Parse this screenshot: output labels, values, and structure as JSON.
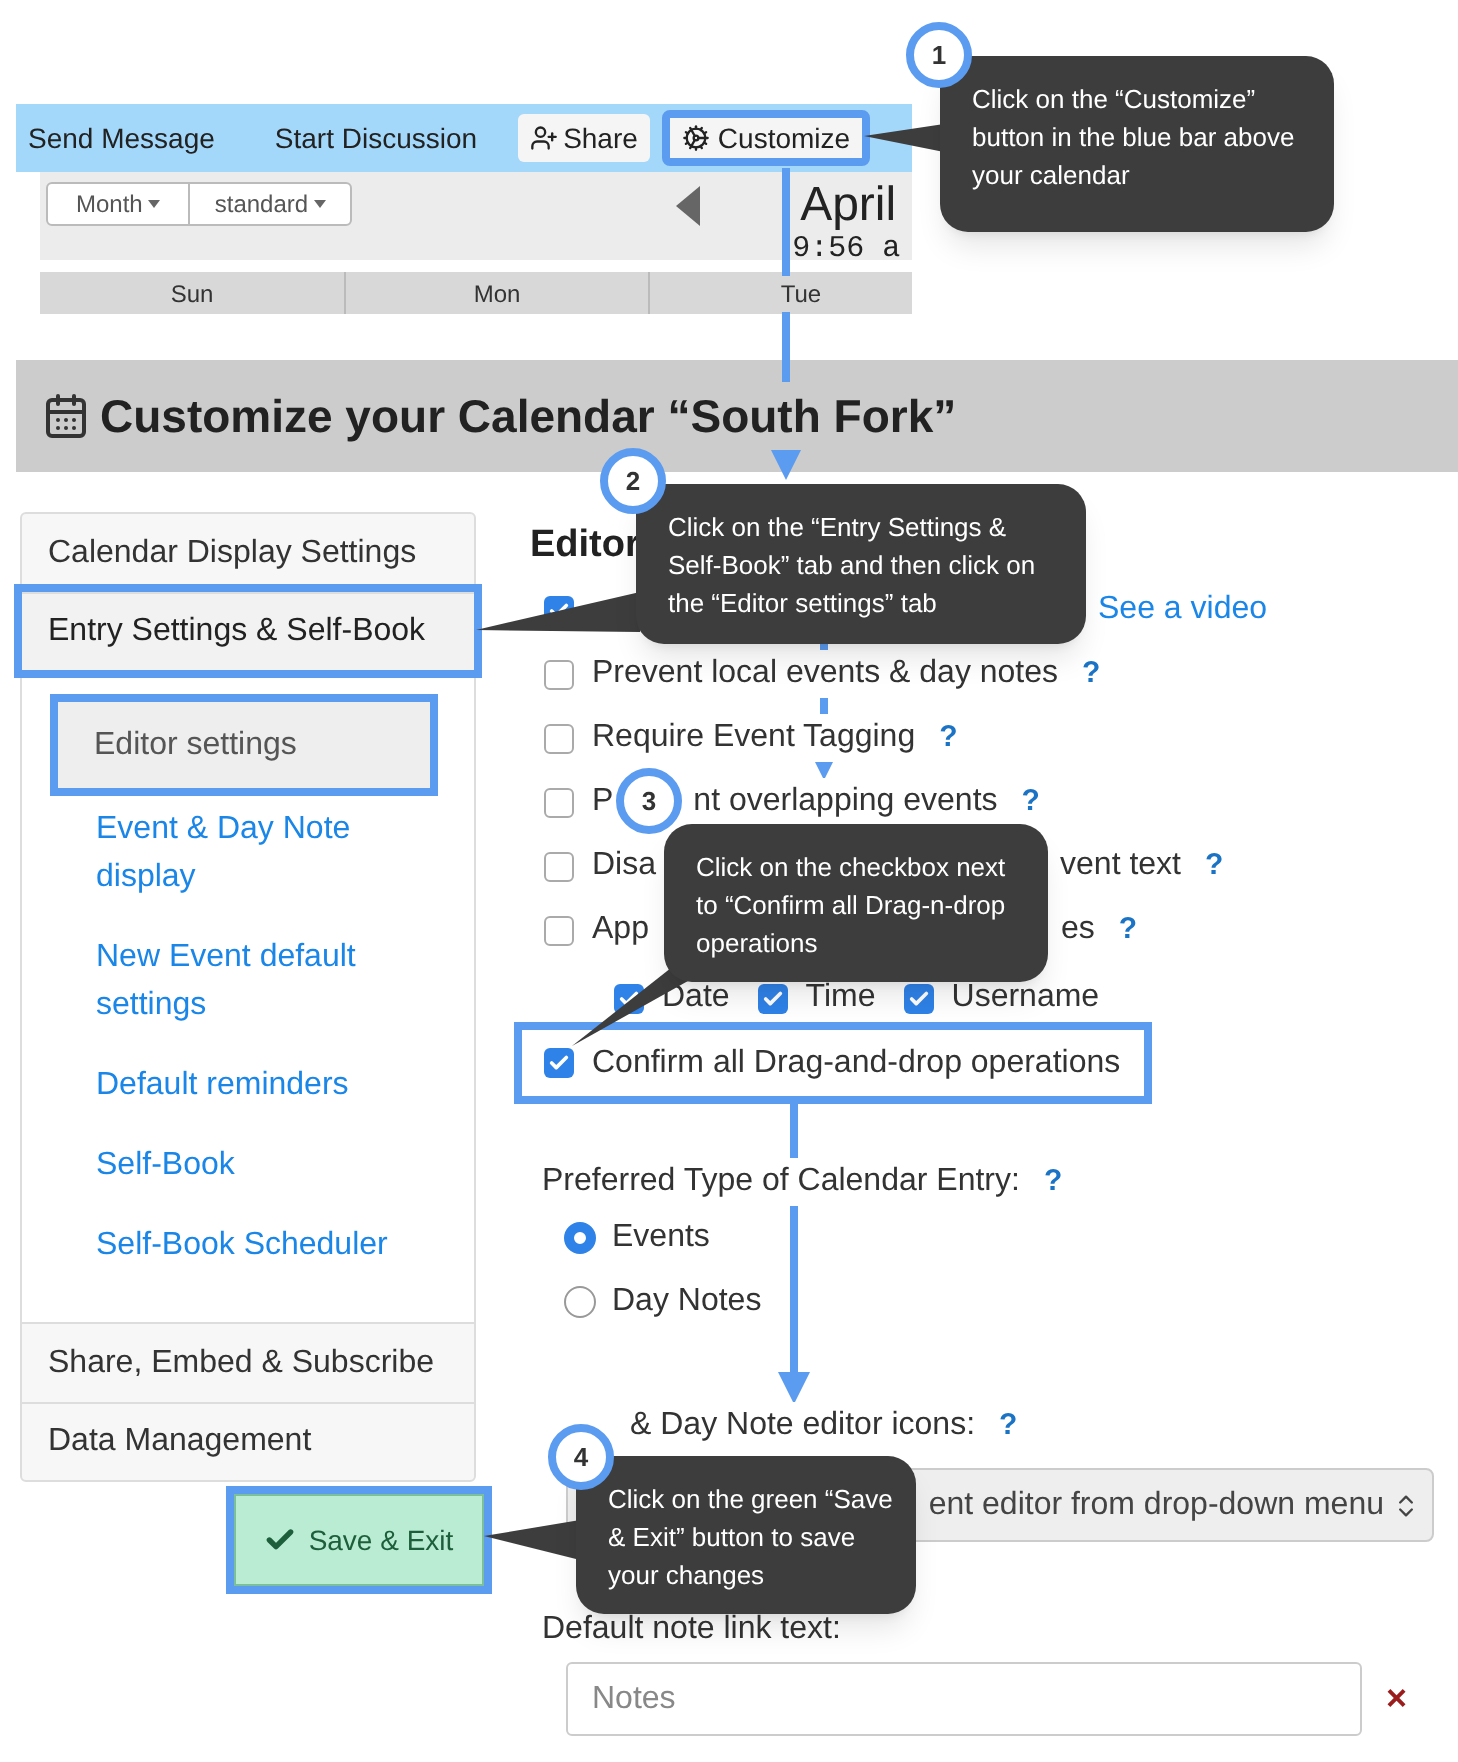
{
  "top_bar": {
    "items": [
      "Send Message",
      "Start Discussion"
    ],
    "share": "Share",
    "customize": {
      "label": "Customize",
      "highlighted": true
    }
  },
  "calendar_toolbar": {
    "view": "Month",
    "style": "standard",
    "month": "April",
    "time": "9:56 a"
  },
  "day_headers": [
    "Sun",
    "Mon",
    "Tue"
  ],
  "page_title": "Customize your Calendar “South Fork”",
  "sidebar": {
    "items": [
      {
        "label": "Calendar Display Settings",
        "selected": false,
        "highlighted": false
      },
      {
        "label": "Entry Settings & Self-Book",
        "selected": true,
        "highlighted": true,
        "children": [
          {
            "label": "Editor settings",
            "selected": true,
            "highlighted": true
          },
          {
            "label": "Event & Day Note display",
            "selected": false,
            "highlighted": false
          },
          {
            "label": "New Event default settings",
            "selected": false,
            "highlighted": false
          },
          {
            "label": "Default reminders",
            "selected": false,
            "highlighted": false
          },
          {
            "label": "Self-Book",
            "selected": false,
            "highlighted": false
          },
          {
            "label": "Self-Book Scheduler",
            "selected": false,
            "highlighted": false
          }
        ]
      },
      {
        "label": "Share, Embed & Subscribe",
        "selected": false,
        "highlighted": false
      },
      {
        "label": "Data Management",
        "selected": false,
        "highlighted": false
      }
    ]
  },
  "save_button": {
    "label": "Save & Exit",
    "highlighted": true
  },
  "editor": {
    "heading": "Editor",
    "options": [
      {
        "checked": true,
        "link": "See a video"
      },
      {
        "checked": false,
        "text": "Prevent local events & day notes",
        "help": "?"
      },
      {
        "checked": false,
        "text": "Require Event Tagging",
        "help": "?"
      },
      {
        "checked": false,
        "text": "P",
        "tail": "nt overlapping events",
        "help": "?"
      },
      {
        "checked": false,
        "text": "Disa",
        "tail": "vent text",
        "help": "?"
      },
      {
        "checked": false,
        "text": "App",
        "tail": "es",
        "help": "?"
      }
    ],
    "show_fields": [
      {
        "label": "Date",
        "checked": true
      },
      {
        "label": "Time",
        "checked": true
      },
      {
        "label": "Username",
        "checked": true
      }
    ],
    "confirm": {
      "label": "Confirm all Drag-and-drop operations",
      "checked": true,
      "highlighted": true
    },
    "entry_type": {
      "label": "Preferred Type of Calendar Entry:",
      "help": "?",
      "options": [
        {
          "label": "Events",
          "selected": true
        },
        {
          "label": "Day Notes",
          "selected": false
        }
      ]
    },
    "icons": {
      "label": "& Day Note editor icons:",
      "help": "?",
      "value": "ent editor from drop-down menu"
    },
    "note_link": {
      "label": "Default note link text:",
      "placeholder": "Notes",
      "clear": "×"
    }
  },
  "callouts": [
    {
      "number": "1",
      "text": "Click on the “Customize” button in the blue bar above your calendar"
    },
    {
      "number": "2",
      "text": "Click on the “Entry Settings & Self-Book” tab and then click on the “Editor settings” tab"
    },
    {
      "number": "3",
      "text": "Click on the checkbox next to “Confirm all Drag-n-drop operations"
    },
    {
      "number": "4",
      "text": "Click on the green “Save & Exit” button to save your changes"
    }
  ]
}
